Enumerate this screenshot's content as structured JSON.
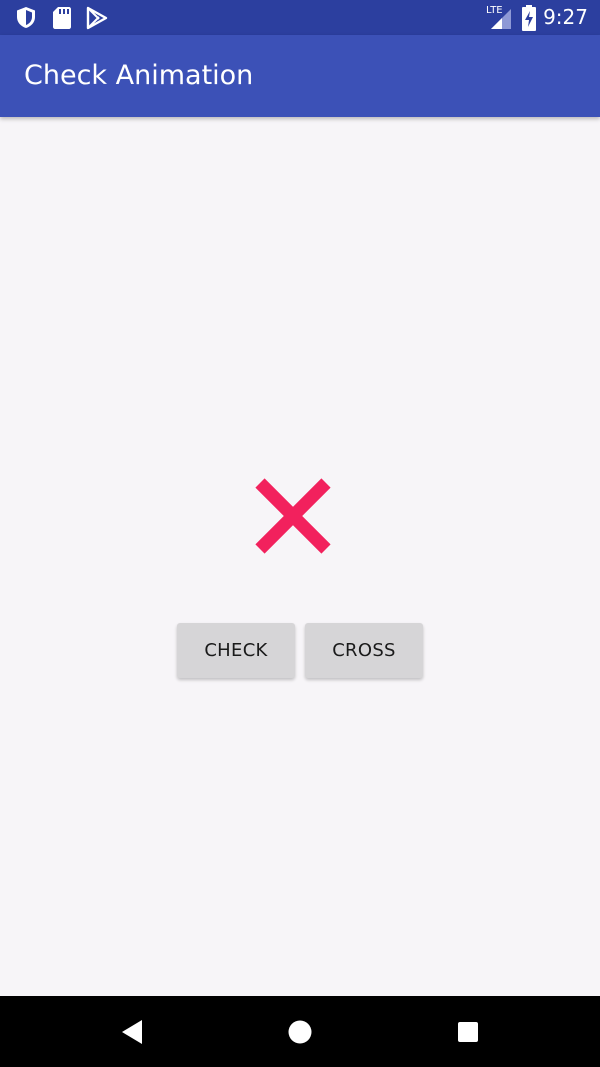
{
  "status_bar": {
    "time": "9:27",
    "network_label": "LTE",
    "icons": [
      "shield-icon",
      "sd-card-icon",
      "play-store-icon",
      "signal-icon",
      "battery-charging-icon"
    ]
  },
  "app_bar": {
    "title": "Check Animation"
  },
  "main": {
    "glyph": "cross-icon",
    "glyph_color": "#f2215d",
    "buttons": [
      {
        "label": "CHECK"
      },
      {
        "label": "CROSS"
      }
    ]
  },
  "nav_bar": {
    "icons": [
      "back-icon",
      "home-icon",
      "recents-icon"
    ]
  },
  "colors": {
    "status_bar": "#2c3f9f",
    "app_bar": "#3c51b7",
    "background": "#f7f5f8",
    "button": "#d6d5d7"
  }
}
